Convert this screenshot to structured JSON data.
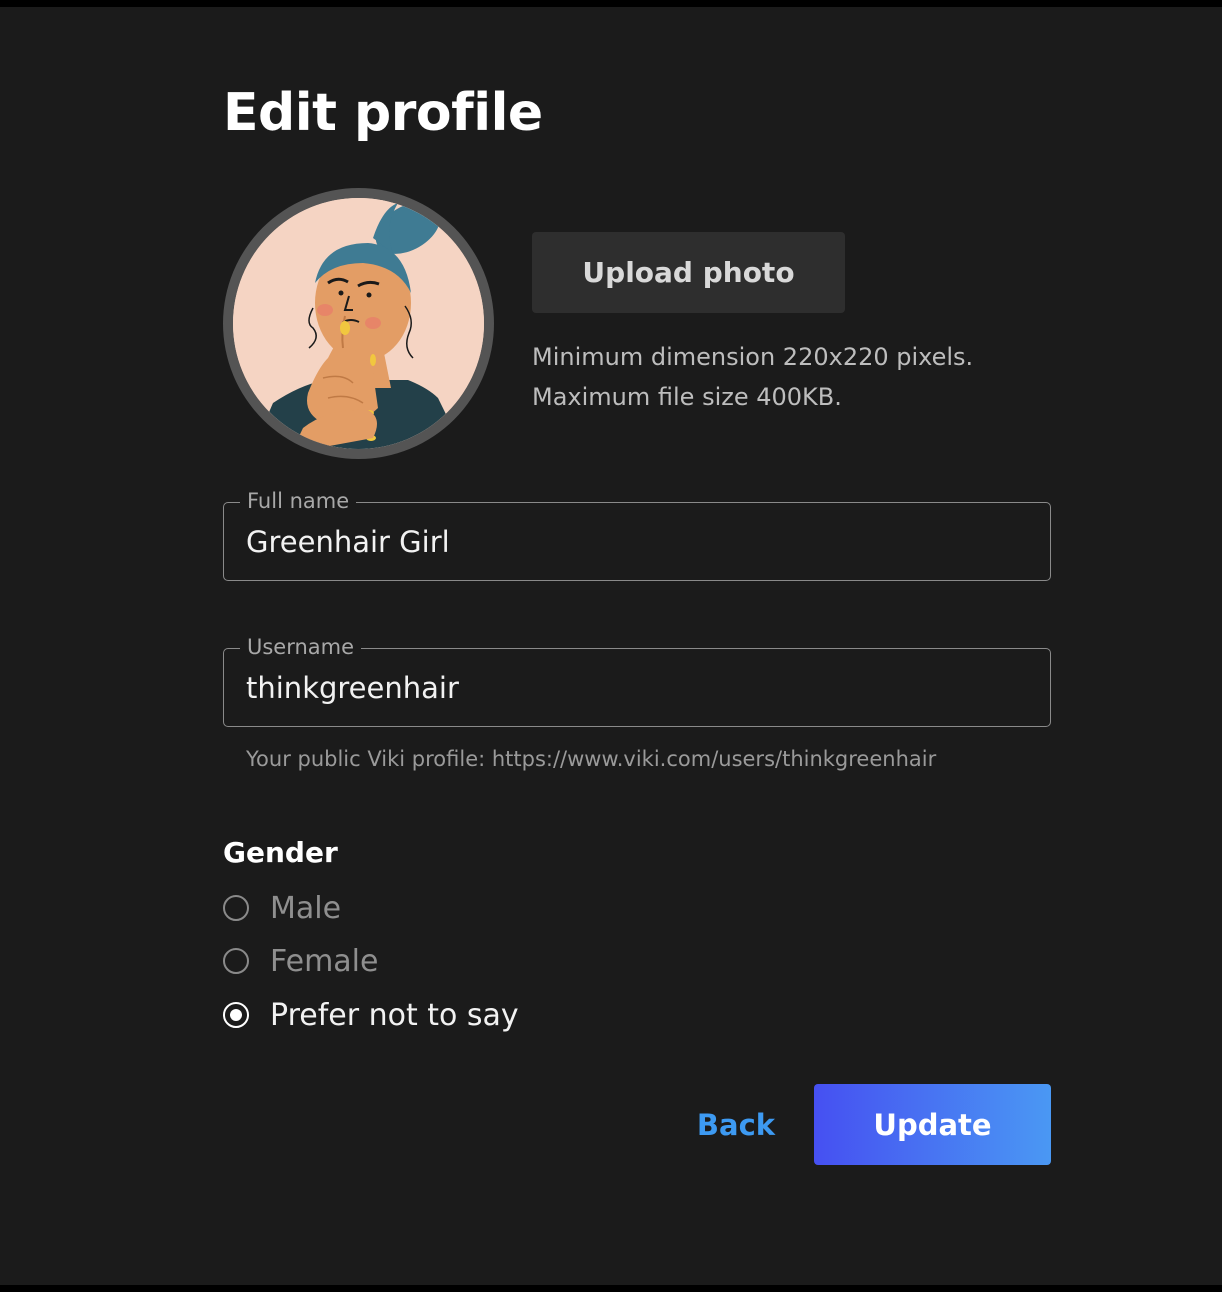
{
  "page": {
    "title": "Edit profile"
  },
  "avatar": {
    "icon": "avatar-illustration",
    "colors": {
      "background": "#f5d4c3",
      "ring": "#545454",
      "hair": "#3f7b93",
      "skin": "#e39d65",
      "shirt": "#234049",
      "nails": "#f1c73f"
    }
  },
  "upload": {
    "button_label": "Upload photo",
    "hint_line1": "Minimum dimension 220x220 pixels.",
    "hint_line2": "Maximum file size 400KB."
  },
  "form": {
    "full_name": {
      "label": "Full name",
      "value": "Greenhair Girl"
    },
    "username": {
      "label": "Username",
      "value": "thinkgreenhair",
      "helper": "Your public Viki profile: https://www.viki.com/users/thinkgreenhair"
    }
  },
  "gender": {
    "heading": "Gender",
    "options": [
      {
        "label": "Male",
        "selected": false
      },
      {
        "label": "Female",
        "selected": false
      },
      {
        "label": "Prefer not to say",
        "selected": true
      }
    ]
  },
  "actions": {
    "back_label": "Back",
    "update_label": "Update"
  },
  "colors": {
    "page_background": "#1b1b1b",
    "accent_link": "#3d9af2",
    "update_gradient_start": "#4650f2",
    "update_gradient_end": "#4a98f3"
  }
}
